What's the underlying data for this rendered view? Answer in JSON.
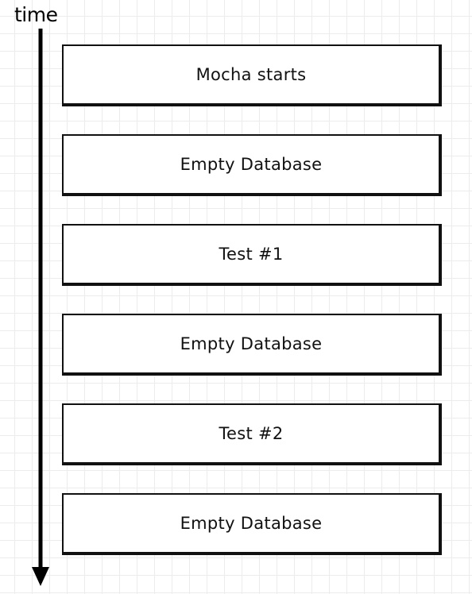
{
  "axis": {
    "label": "time"
  },
  "steps": [
    {
      "label": "Mocha starts"
    },
    {
      "label": "Empty Database"
    },
    {
      "label": "Test #1"
    },
    {
      "label": "Empty Database"
    },
    {
      "label": "Test #2"
    },
    {
      "label": "Empty Database"
    }
  ]
}
